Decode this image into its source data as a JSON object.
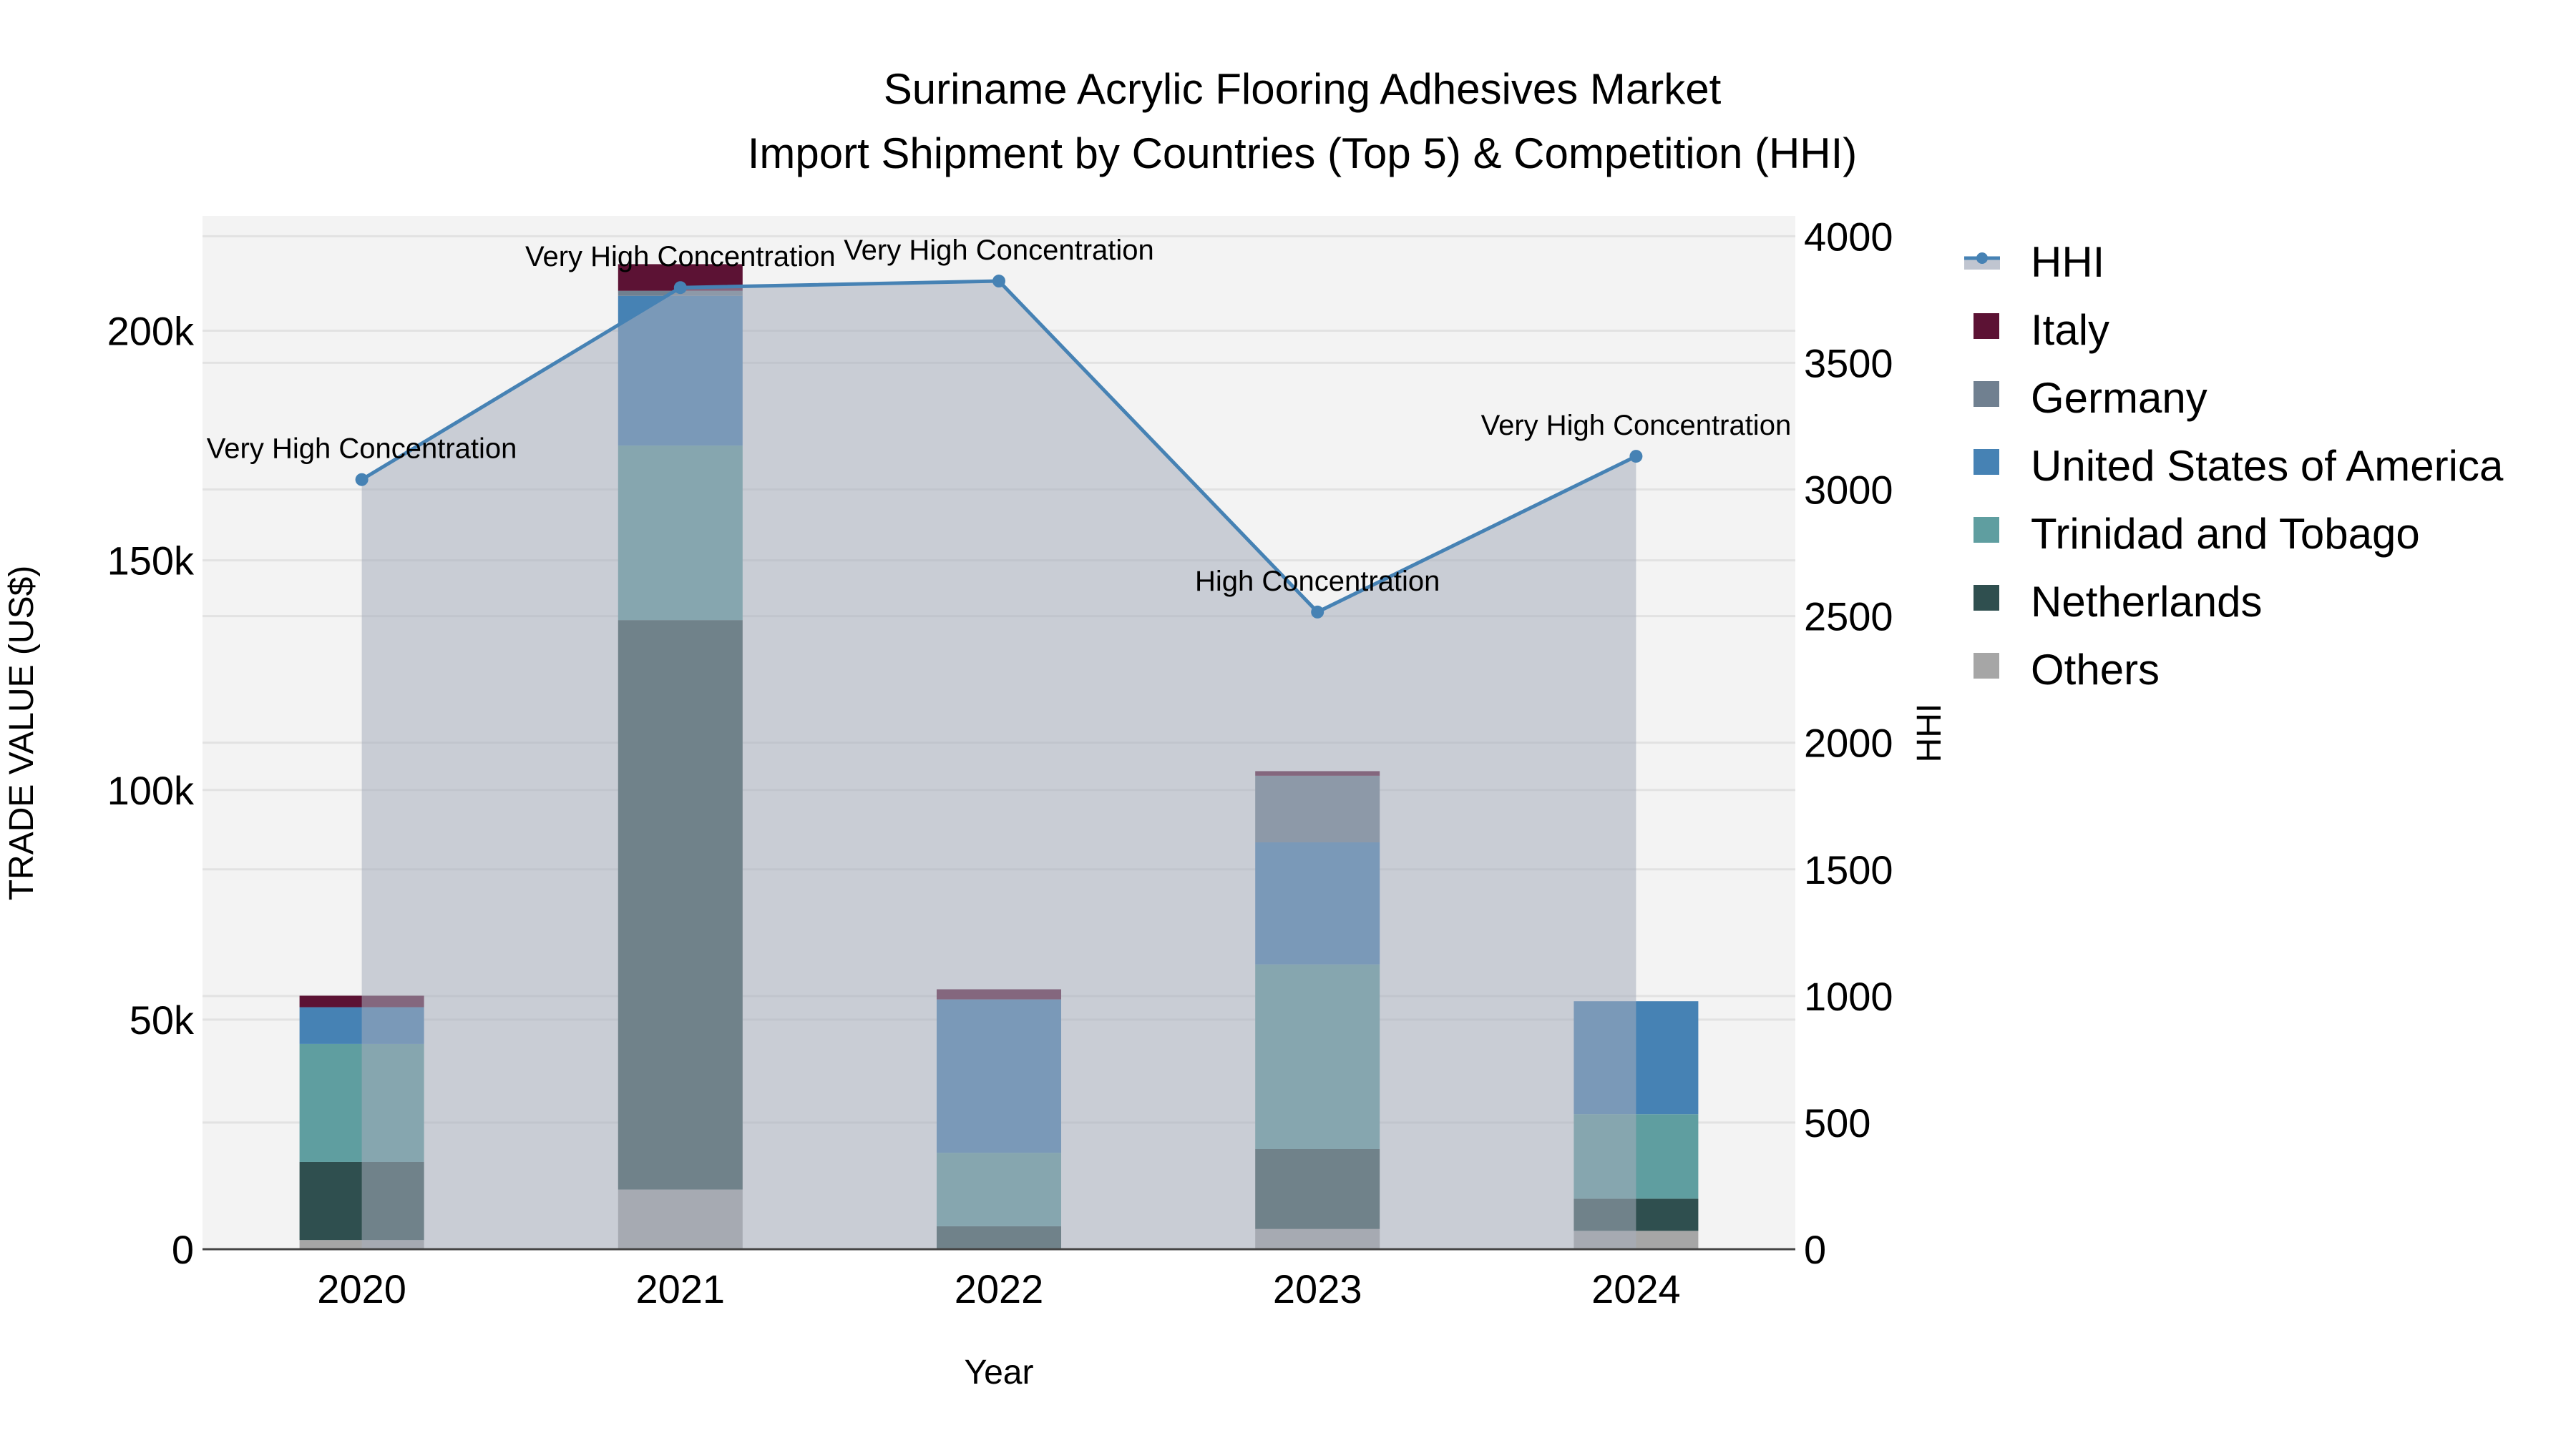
{
  "chart_data": {
    "type": "bar",
    "title": "Suriname Acrylic Flooring Adhesives Market",
    "subtitle": "Import Shipment by Countries (Top 5) & Competition (HHI)",
    "xlabel": "Year",
    "ylabel": "TRADE VALUE (US$)",
    "y2label": "HHI",
    "categories": [
      "2020",
      "2021",
      "2022",
      "2023",
      "2024"
    ],
    "ylim": [
      0,
      225000
    ],
    "y2lim": [
      0,
      4080
    ],
    "yticks": [
      {
        "v": 0,
        "label": "0"
      },
      {
        "v": 50000,
        "label": "50k"
      },
      {
        "v": 100000,
        "label": "100k"
      },
      {
        "v": 150000,
        "label": "150k"
      },
      {
        "v": 200000,
        "label": "200k"
      }
    ],
    "y2ticks": [
      {
        "v": 0,
        "label": "0"
      },
      {
        "v": 500,
        "label": "500"
      },
      {
        "v": 1000,
        "label": "1000"
      },
      {
        "v": 1500,
        "label": "1500"
      },
      {
        "v": 2000,
        "label": "2000"
      },
      {
        "v": 2500,
        "label": "2500"
      },
      {
        "v": 3000,
        "label": "3000"
      },
      {
        "v": 3500,
        "label": "3500"
      },
      {
        "v": 4000,
        "label": "4000"
      }
    ],
    "series": [
      {
        "name": "Others",
        "color": "#a6a6a6",
        "values": [
          2000,
          13000,
          0,
          4400,
          4000
        ]
      },
      {
        "name": "Netherlands",
        "color": "#2f4f4f",
        "values": [
          17000,
          124000,
          5000,
          17400,
          7000
        ]
      },
      {
        "name": "Trinidad and Tobago",
        "color": "#5f9ea0",
        "values": [
          25700,
          38000,
          16000,
          40200,
          18400
        ]
      },
      {
        "name": "United States of America",
        "color": "#4682b4",
        "values": [
          8000,
          32600,
          33400,
          26600,
          24600
        ]
      },
      {
        "name": "Germany",
        "color": "#708090",
        "values": [
          0,
          1100,
          0,
          14500,
          0
        ]
      },
      {
        "name": "Italy",
        "color": "#5c1234",
        "values": [
          2500,
          5800,
          2200,
          1000,
          0
        ]
      }
    ],
    "hhi": {
      "name": "HHI",
      "color": "#4682b4",
      "values": [
        3039,
        3797,
        3823,
        2516,
        3131
      ],
      "labels": [
        "Very High Concentration",
        "Very High Concentration",
        "Very High Concentration",
        "High Concentration",
        "Very High Concentration"
      ]
    },
    "legend_order": [
      "HHI",
      "Italy",
      "Germany",
      "United States of America",
      "Trinidad and Tobago",
      "Netherlands",
      "Others"
    ],
    "legend_placement": "right",
    "grid": true
  }
}
